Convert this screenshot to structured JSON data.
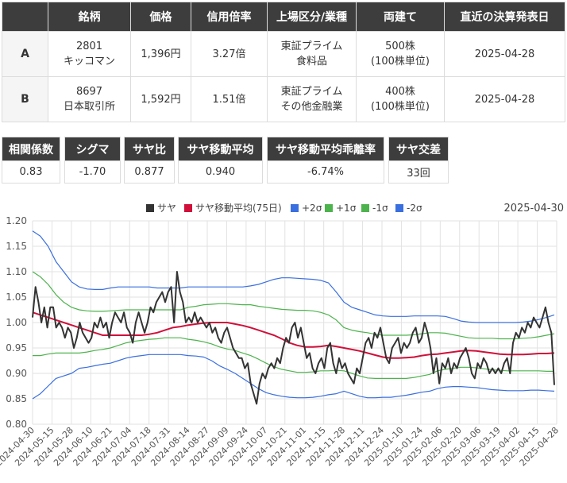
{
  "table": {
    "headers": [
      "",
      "銘柄",
      "価格",
      "信用倍率",
      "上場区分/業種",
      "両建て",
      "直近の決算発表日"
    ],
    "rows": [
      {
        "label": "A",
        "code": "2801",
        "name": "キッコマン",
        "price": "1,396円",
        "margin_ratio": "3.27倍",
        "market": "東証プライム",
        "sector": "食料品",
        "hedge": "500株",
        "unit": "(100株単位)",
        "earnings_date": "2025-04-28"
      },
      {
        "label": "B",
        "code": "8697",
        "name": "日本取引所",
        "price": "1,592円",
        "margin_ratio": "1.51倍",
        "market": "東証プライム",
        "sector": "その他金融業",
        "hedge": "400株",
        "unit": "(100株単位)",
        "earnings_date": "2025-04-28"
      }
    ]
  },
  "stats": [
    {
      "label": "相関係数",
      "value": "0.83"
    },
    {
      "label": "シグマ",
      "value": "-1.70"
    },
    {
      "label": "サヤ比",
      "value": "0.877"
    },
    {
      "label": "サヤ移動平均",
      "value": "0.940"
    },
    {
      "label": "サヤ移動平均乖離率",
      "value": "-6.74%"
    },
    {
      "label": "サヤ交差",
      "value": "33回"
    }
  ],
  "chart_data": {
    "type": "line",
    "date_label": "2025-04-30",
    "ylim": [
      0.8,
      1.2
    ],
    "yticks": [
      "0.80",
      "0.85",
      "0.90",
      "0.95",
      "1.00",
      "1.05",
      "1.10",
      "1.15",
      "1.20"
    ],
    "grid": true,
    "legend_position": "top",
    "x_ticks": [
      "2024-04-30",
      "2024-05-15",
      "2024-05-28",
      "2024-06-10",
      "2024-06-21",
      "2024-07-04",
      "2024-07-18",
      "2024-07-31",
      "2024-08-14",
      "2024-08-27",
      "2024-09-09",
      "2024-09-24",
      "2024-10-07",
      "2024-10-21",
      "2024-11-01",
      "2024-11-15",
      "2024-11-28",
      "2024-12-11",
      "2024-12-24",
      "2025-01-10",
      "2025-01-24",
      "2025-02-06",
      "2025-02-20",
      "2025-03-06",
      "2025-03-19",
      "2025-04-02",
      "2025-04-15",
      "2025-04-28"
    ],
    "series": [
      {
        "name": "サヤ",
        "color": "#333333",
        "values": [
          1.01,
          1.07,
          1.04,
          1.0,
          1.03,
          0.99,
          1.03,
          1.03,
          0.99,
          1.0,
          0.99,
          0.97,
          0.99,
          0.98,
          0.95,
          0.97,
          1.0,
          0.98,
          0.97,
          0.96,
          0.97,
          1.0,
          0.99,
          1.01,
          0.99,
          1.0,
          0.97,
          1.0,
          1.02,
          1.01,
          1.0,
          1.02,
          0.99,
          0.98,
          0.96,
          1.0,
          1.02,
          1.0,
          0.98,
          1.0,
          1.03,
          1.02,
          1.04,
          1.05,
          1.06,
          1.04,
          1.06,
          1.07,
          1.0,
          1.1,
          1.06,
          1.04,
          1.0,
          1.01,
          1.0,
          1.02,
          1.0,
          1.01,
          1.0,
          0.99,
          1.0,
          0.98,
          0.99,
          0.97,
          0.96,
          0.98,
          0.99,
          0.97,
          0.95,
          0.94,
          0.93,
          0.93,
          0.91,
          0.92,
          0.88,
          0.86,
          0.84,
          0.88,
          0.9,
          0.89,
          0.91,
          0.92,
          0.91,
          0.93,
          0.92,
          0.95,
          0.97,
          0.96,
          0.99,
          1.0,
          0.97,
          0.99,
          0.96,
          0.93,
          0.94,
          0.91,
          0.9,
          0.92,
          0.93,
          0.91,
          0.95,
          0.96,
          0.92,
          0.9,
          0.93,
          0.91,
          0.92,
          0.9,
          0.89,
          0.88,
          0.91,
          0.9,
          0.93,
          0.96,
          0.97,
          0.95,
          0.98,
          0.97,
          0.99,
          0.96,
          0.93,
          0.92,
          0.95,
          0.96,
          0.97,
          0.94,
          0.96,
          0.95,
          0.96,
          0.98,
          0.99,
          0.96,
          0.97,
          1.0,
          0.98,
          0.95,
          0.9,
          0.93,
          0.88,
          0.92,
          0.91,
          0.93,
          0.9,
          0.92,
          0.91,
          0.93,
          0.94,
          0.95,
          0.93,
          0.9,
          0.89,
          0.92,
          0.91,
          0.93,
          0.92,
          0.9,
          0.91,
          0.9,
          0.91,
          0.9,
          0.92,
          0.93,
          0.9,
          0.96,
          0.98,
          0.97,
          0.99,
          0.98,
          1.0,
          0.99,
          1.01,
          1.0,
          0.99,
          1.01,
          1.03,
          1.0,
          0.98,
          0.877
        ]
      },
      {
        "name": "サヤ移動平均(75日)",
        "color": "#d0103a",
        "values": [
          1.02,
          1.015,
          1.01,
          1.005,
          1.0,
          0.995,
          0.99,
          0.985,
          0.98,
          0.975,
          0.975,
          0.975,
          0.975,
          0.975,
          0.975,
          0.977,
          0.98,
          0.985,
          0.99,
          0.992,
          0.995,
          0.997,
          0.999,
          1.0,
          1.0,
          1.0,
          0.997,
          0.994,
          0.99,
          0.985,
          0.98,
          0.975,
          0.968,
          0.96,
          0.955,
          0.952,
          0.952,
          0.953,
          0.955,
          0.953,
          0.95,
          0.947,
          0.944,
          0.94,
          0.936,
          0.932,
          0.93,
          0.93,
          0.931,
          0.932,
          0.935,
          0.937,
          0.938,
          0.94,
          0.942,
          0.944,
          0.945,
          0.944,
          0.942,
          0.94,
          0.938,
          0.937,
          0.937,
          0.937,
          0.938,
          0.939,
          0.939,
          0.94
        ]
      },
      {
        "name": "+2σ",
        "color": "#3a6fe0",
        "values": [
          1.18,
          1.17,
          1.15,
          1.12,
          1.1,
          1.08,
          1.07,
          1.066,
          1.065,
          1.065,
          1.068,
          1.07,
          1.07,
          1.07,
          1.07,
          1.07,
          1.068,
          1.068,
          1.068,
          1.068,
          1.07,
          1.07,
          1.07,
          1.07,
          1.07,
          1.07,
          1.07,
          1.07,
          1.072,
          1.075,
          1.08,
          1.085,
          1.088,
          1.088,
          1.087,
          1.086,
          1.085,
          1.083,
          1.078,
          1.06,
          1.04,
          1.03,
          1.025,
          1.02,
          1.015,
          1.013,
          1.012,
          1.012,
          1.012,
          1.013,
          1.013,
          1.013,
          1.013,
          1.012,
          1.008,
          1.003,
          1.001,
          1.0,
          1.0,
          1.0,
          1.0,
          1.0,
          1.0,
          1.001,
          1.003,
          1.006,
          1.01,
          1.015
        ]
      },
      {
        "name": "+1σ",
        "color": "#4db34d",
        "values": [
          1.1,
          1.09,
          1.075,
          1.055,
          1.04,
          1.03,
          1.025,
          1.023,
          1.022,
          1.022,
          1.023,
          1.024,
          1.025,
          1.025,
          1.025,
          1.025,
          1.025,
          1.025,
          1.025,
          1.025,
          1.03,
          1.032,
          1.035,
          1.036,
          1.037,
          1.037,
          1.036,
          1.035,
          1.035,
          1.032,
          1.03,
          1.028,
          1.026,
          1.025,
          1.024,
          1.024,
          1.023,
          1.02,
          1.015,
          1.005,
          0.99,
          0.985,
          0.982,
          0.98,
          0.977,
          0.975,
          0.975,
          0.975,
          0.975,
          0.976,
          0.978,
          0.98,
          0.98,
          0.979,
          0.976,
          0.973,
          0.97,
          0.969,
          0.969,
          0.969,
          0.968,
          0.968,
          0.968,
          0.969,
          0.97,
          0.972,
          0.975,
          0.978
        ]
      },
      {
        "name": "-1σ",
        "color": "#4db34d",
        "values": [
          0.935,
          0.935,
          0.938,
          0.94,
          0.94,
          0.94,
          0.94,
          0.942,
          0.945,
          0.947,
          0.95,
          0.955,
          0.96,
          0.963,
          0.965,
          0.967,
          0.968,
          0.97,
          0.97,
          0.97,
          0.967,
          0.965,
          0.962,
          0.958,
          0.952,
          0.948,
          0.945,
          0.94,
          0.935,
          0.928,
          0.92,
          0.913,
          0.908,
          0.905,
          0.902,
          0.902,
          0.903,
          0.905,
          0.905,
          0.906,
          0.905,
          0.9,
          0.895,
          0.891,
          0.89,
          0.89,
          0.89,
          0.89,
          0.89,
          0.892,
          0.895,
          0.898,
          0.905,
          0.908,
          0.91,
          0.912,
          0.912,
          0.911,
          0.909,
          0.907,
          0.906,
          0.905,
          0.905,
          0.905,
          0.905,
          0.905,
          0.904,
          0.904
        ]
      },
      {
        "name": "-2σ",
        "color": "#3a6fe0",
        "values": [
          0.85,
          0.86,
          0.875,
          0.89,
          0.895,
          0.9,
          0.91,
          0.912,
          0.915,
          0.918,
          0.92,
          0.925,
          0.93,
          0.933,
          0.935,
          0.937,
          0.937,
          0.937,
          0.937,
          0.937,
          0.935,
          0.934,
          0.932,
          0.925,
          0.915,
          0.908,
          0.9,
          0.89,
          0.88,
          0.87,
          0.862,
          0.858,
          0.855,
          0.853,
          0.852,
          0.852,
          0.853,
          0.855,
          0.858,
          0.86,
          0.865,
          0.86,
          0.855,
          0.852,
          0.852,
          0.853,
          0.853,
          0.855,
          0.857,
          0.86,
          0.863,
          0.865,
          0.87,
          0.873,
          0.874,
          0.874,
          0.873,
          0.872,
          0.87,
          0.868,
          0.867,
          0.866,
          0.866,
          0.866,
          0.867,
          0.867,
          0.866,
          0.865
        ]
      }
    ]
  }
}
